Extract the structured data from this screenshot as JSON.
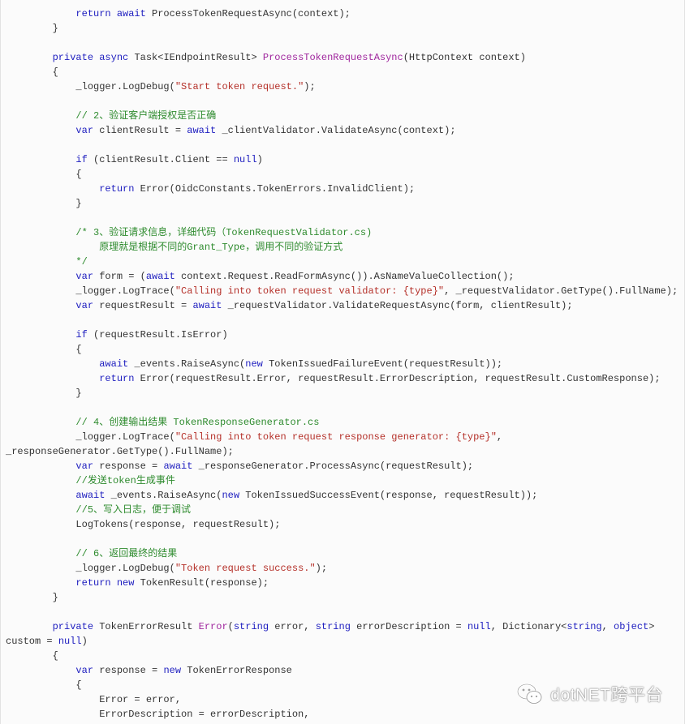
{
  "code_lines": [
    [
      [
        "kw",
        "            return await "
      ],
      [
        "pl",
        "ProcessTokenRequestAsync(context);"
      ]
    ],
    [
      [
        "pl",
        "        }"
      ]
    ],
    [
      [
        "pl",
        ""
      ]
    ],
    [
      [
        "kw",
        "        private async "
      ],
      [
        "pl",
        "Task<IEndpointResult> "
      ],
      [
        "fn",
        "ProcessTokenRequestAsync"
      ],
      [
        "pl",
        "(HttpContext context)"
      ]
    ],
    [
      [
        "pl",
        "        {"
      ]
    ],
    [
      [
        "pl",
        "            _logger.LogDebug("
      ],
      [
        "str",
        "\"Start token request.\""
      ],
      [
        "pl",
        ");"
      ]
    ],
    [
      [
        "pl",
        ""
      ]
    ],
    [
      [
        "cmt",
        "            // 2、验证客户端授权是否正确"
      ]
    ],
    [
      [
        "kw",
        "            var "
      ],
      [
        "pl",
        "clientResult = "
      ],
      [
        "kw",
        "await "
      ],
      [
        "pl",
        "_clientValidator.ValidateAsync(context);"
      ]
    ],
    [
      [
        "pl",
        ""
      ]
    ],
    [
      [
        "kw",
        "            if "
      ],
      [
        "pl",
        "(clientResult.Client == "
      ],
      [
        "kw",
        "null"
      ],
      [
        "pl",
        ")"
      ]
    ],
    [
      [
        "pl",
        "            {"
      ]
    ],
    [
      [
        "kw",
        "                return "
      ],
      [
        "pl",
        "Error(OidcConstants.TokenErrors.InvalidClient);"
      ]
    ],
    [
      [
        "pl",
        "            }"
      ]
    ],
    [
      [
        "pl",
        ""
      ]
    ],
    [
      [
        "cmt",
        "            /* 3、验证请求信息，详细代码（TokenRequestValidator.cs)"
      ]
    ],
    [
      [
        "cmt",
        "                原理就是根据不同的Grant_Type，调用不同的验证方式"
      ]
    ],
    [
      [
        "cmt",
        "            */"
      ]
    ],
    [
      [
        "kw",
        "            var "
      ],
      [
        "pl",
        "form = ("
      ],
      [
        "kw",
        "await "
      ],
      [
        "pl",
        "context.Request.ReadFormAsync()).AsNameValueCollection();"
      ]
    ],
    [
      [
        "pl",
        "            _logger.LogTrace("
      ],
      [
        "str",
        "\"Calling into token request validator: {type}\""
      ],
      [
        "pl",
        ", _requestValidator.GetType().FullName);"
      ]
    ],
    [
      [
        "kw",
        "            var "
      ],
      [
        "pl",
        "requestResult = "
      ],
      [
        "kw",
        "await "
      ],
      [
        "pl",
        "_requestValidator.ValidateRequestAsync(form, clientResult);"
      ]
    ],
    [
      [
        "pl",
        ""
      ]
    ],
    [
      [
        "kw",
        "            if "
      ],
      [
        "pl",
        "(requestResult.IsError)"
      ]
    ],
    [
      [
        "pl",
        "            {"
      ]
    ],
    [
      [
        "kw",
        "                await "
      ],
      [
        "pl",
        "_events.RaiseAsync("
      ],
      [
        "kw",
        "new "
      ],
      [
        "pl",
        "TokenIssuedFailureEvent(requestResult));"
      ]
    ],
    [
      [
        "kw",
        "                return "
      ],
      [
        "pl",
        "Error(requestResult.Error, requestResult.ErrorDescription, requestResult.CustomResponse);"
      ]
    ],
    [
      [
        "pl",
        "            }"
      ]
    ],
    [
      [
        "pl",
        ""
      ]
    ],
    [
      [
        "cmt",
        "            // 4、创建输出结果 TokenResponseGenerator.cs"
      ]
    ],
    [
      [
        "pl",
        "            _logger.LogTrace("
      ],
      [
        "str",
        "\"Calling into token request response generator: {type}\""
      ],
      [
        "pl",
        ","
      ]
    ],
    [
      [
        "pl",
        "_responseGenerator.GetType().FullName);"
      ]
    ],
    [
      [
        "kw",
        "            var "
      ],
      [
        "pl",
        "response = "
      ],
      [
        "kw",
        "await "
      ],
      [
        "pl",
        "_responseGenerator.ProcessAsync(requestResult);"
      ]
    ],
    [
      [
        "cmt",
        "            //发送token生成事件"
      ]
    ],
    [
      [
        "kw",
        "            await "
      ],
      [
        "pl",
        "_events.RaiseAsync("
      ],
      [
        "kw",
        "new "
      ],
      [
        "pl",
        "TokenIssuedSuccessEvent(response, requestResult));"
      ]
    ],
    [
      [
        "cmt",
        "            //5、写入日志，便于调试"
      ]
    ],
    [
      [
        "pl",
        "            LogTokens(response, requestResult);"
      ]
    ],
    [
      [
        "pl",
        ""
      ]
    ],
    [
      [
        "cmt",
        "            // 6、返回最终的结果"
      ]
    ],
    [
      [
        "pl",
        "            _logger.LogDebug("
      ],
      [
        "str",
        "\"Token request success.\""
      ],
      [
        "pl",
        ");"
      ]
    ],
    [
      [
        "kw",
        "            return new "
      ],
      [
        "pl",
        "TokenResult(response);"
      ]
    ],
    [
      [
        "pl",
        "        }"
      ]
    ],
    [
      [
        "pl",
        ""
      ]
    ],
    [
      [
        "kw",
        "        private "
      ],
      [
        "pl",
        "TokenErrorResult "
      ],
      [
        "fn",
        "Error"
      ],
      [
        "pl",
        "("
      ],
      [
        "kw",
        "string "
      ],
      [
        "pl",
        "error, "
      ],
      [
        "kw",
        "string "
      ],
      [
        "pl",
        "errorDescription = "
      ],
      [
        "kw",
        "null"
      ],
      [
        "pl",
        ", Dictionary<"
      ],
      [
        "kw",
        "string"
      ],
      [
        "pl",
        ", "
      ],
      [
        "kw",
        "object"
      ],
      [
        "pl",
        ">"
      ]
    ],
    [
      [
        "pl",
        "custom = "
      ],
      [
        "kw",
        "null"
      ],
      [
        "pl",
        ")"
      ]
    ],
    [
      [
        "pl",
        "        {"
      ]
    ],
    [
      [
        "kw",
        "            var "
      ],
      [
        "pl",
        "response = "
      ],
      [
        "kw",
        "new "
      ],
      [
        "pl",
        "TokenErrorResponse"
      ]
    ],
    [
      [
        "pl",
        "            {"
      ]
    ],
    [
      [
        "pl",
        "                Error = error,"
      ]
    ],
    [
      [
        "pl",
        "                ErrorDescription = errorDescription,"
      ]
    ]
  ],
  "watermark": {
    "icon": "wechat-icon",
    "text": "dotNET跨平台"
  }
}
